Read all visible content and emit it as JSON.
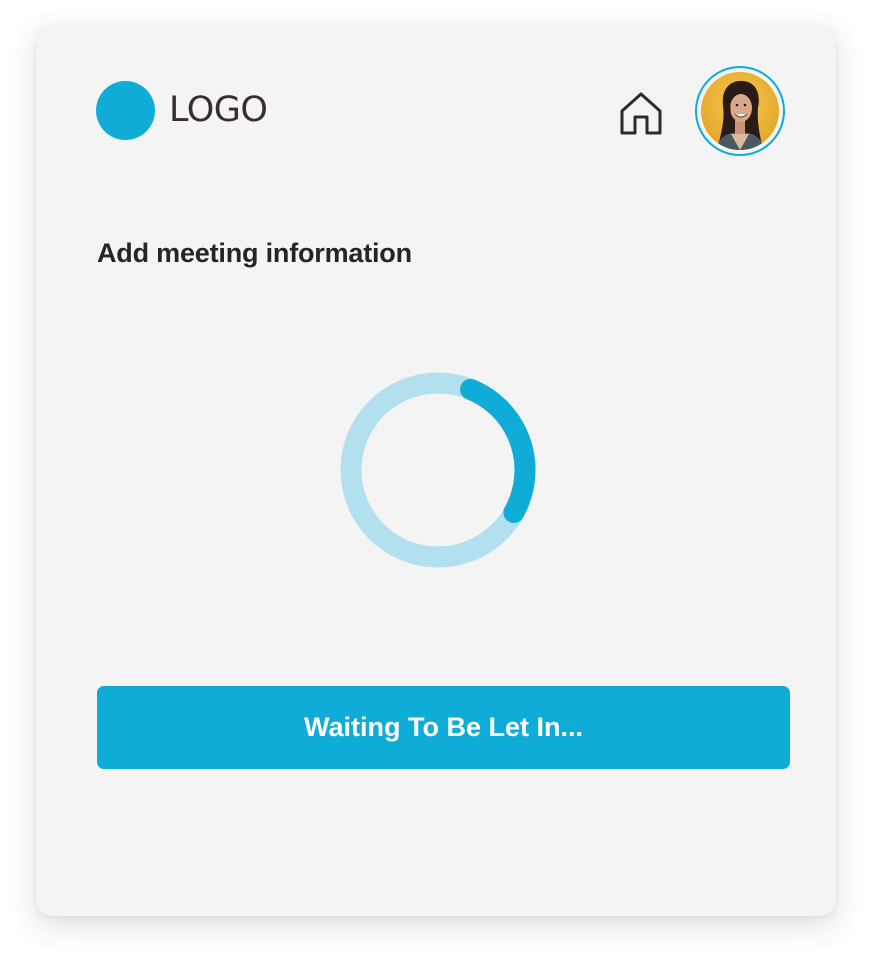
{
  "header": {
    "logo_text": "LOGO",
    "logo_icon": "circle-logo-mark",
    "home_icon": "home-icon",
    "avatar_alt": "user-avatar"
  },
  "main": {
    "title": "Add meeting information",
    "loading": {
      "icon": "loading-spinner",
      "progress": 0.27
    },
    "primary_button_label": "Waiting To Be Let In..."
  },
  "colors": {
    "accent": "#10acd8",
    "accent_light": "#b3e0ee",
    "card_bg": "#f4f4f5",
    "logo_text": "#3a2c33",
    "heading_text": "#24242a",
    "avatar_bg": "#f1b93a"
  }
}
